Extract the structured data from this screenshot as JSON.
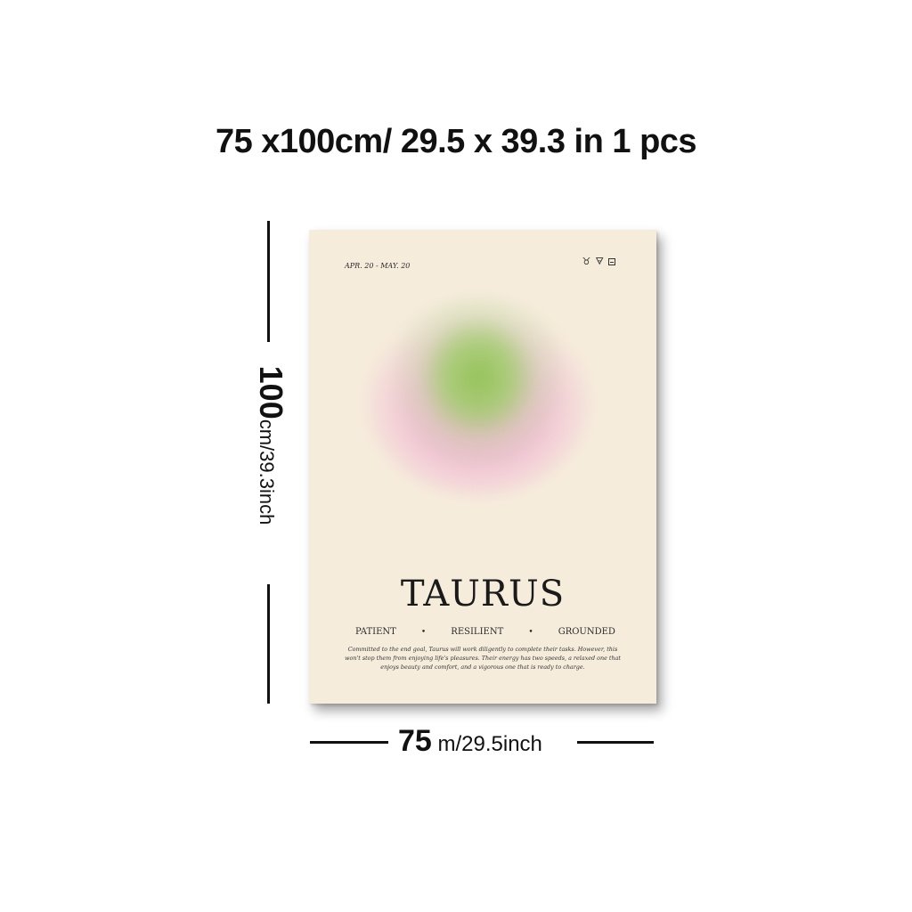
{
  "headline": "75 x100cm/ 29.5 x 39.3 in 1 pcs",
  "height_label": {
    "number": "100",
    "unit": "cm/39.3inch"
  },
  "width_label": {
    "number": "75",
    "unit": " m/29.5inch"
  },
  "poster": {
    "date_range": "APR. 20 - MAY. 20",
    "symbols": [
      "♉",
      "🜃",
      "box-glyph"
    ],
    "symbol_taurus": "♉",
    "symbol_earth": "🜃",
    "title": "TAURUS",
    "traits": [
      "PATIENT",
      "RESILIENT",
      "GROUNDED"
    ],
    "bullet": "•",
    "description": "Committed to the end goal, Taurus will work diligently to complete their tasks. However, this won't stop them from enjoying life's pleasures. Their energy has two speeds, a relaxed one that enjoys beauty and comfort, and a vigorous one that is ready to charge.",
    "colors": {
      "background": "#f6ecdc",
      "orb_green": "#96c35a",
      "orb_pink": "#eea0c8"
    }
  }
}
